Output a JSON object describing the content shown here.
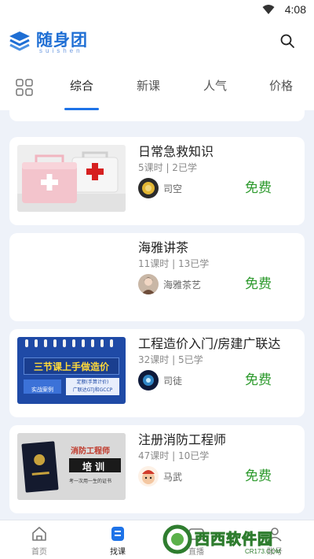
{
  "status_bar": {
    "time": "4:08"
  },
  "header": {
    "logo_cn": "随身团",
    "logo_en": "suishen"
  },
  "tabs": [
    {
      "label": "综合",
      "active": true
    },
    {
      "label": "新课",
      "active": false
    },
    {
      "label": "人气",
      "active": false
    },
    {
      "label": "价格",
      "active": false
    }
  ],
  "courses": [
    {
      "title": "日常急救知识",
      "meta": "5课时 | 2已学",
      "teacher": "司空",
      "price": "免费"
    },
    {
      "title": "海雅讲茶",
      "meta": "11课时 | 13已学",
      "teacher": "海雅茶艺",
      "price": "免费"
    },
    {
      "title": "工程造价入门/房建广联达",
      "meta": "32课时 | 5已学",
      "teacher": "司徒",
      "price": "免费",
      "thumb": {
        "headline": "三节课上手做造价",
        "left_tag": "实战案例",
        "right_line1": "定额(手算计价)",
        "right_line2": "广联达GTJ和GCCP"
      }
    },
    {
      "title": "注册消防工程师",
      "meta": "47课时 | 10已学",
      "teacher": "马武",
      "price": "免费",
      "thumb": {
        "headline": "消防工程师",
        "banner": "培训",
        "sub": "考一次用一生的证书"
      }
    }
  ],
  "bottom_nav": [
    {
      "label": "首页",
      "active": false
    },
    {
      "label": "找课",
      "active": true
    },
    {
      "label": "直播",
      "active": false
    },
    {
      "label": "账号",
      "active": false
    }
  ],
  "watermark": {
    "brand": "西西软件园",
    "url": "CR173.COM"
  },
  "colors": {
    "accent": "#1e73e8",
    "price": "#2d9a2d",
    "logo": "#1e6ed4"
  }
}
